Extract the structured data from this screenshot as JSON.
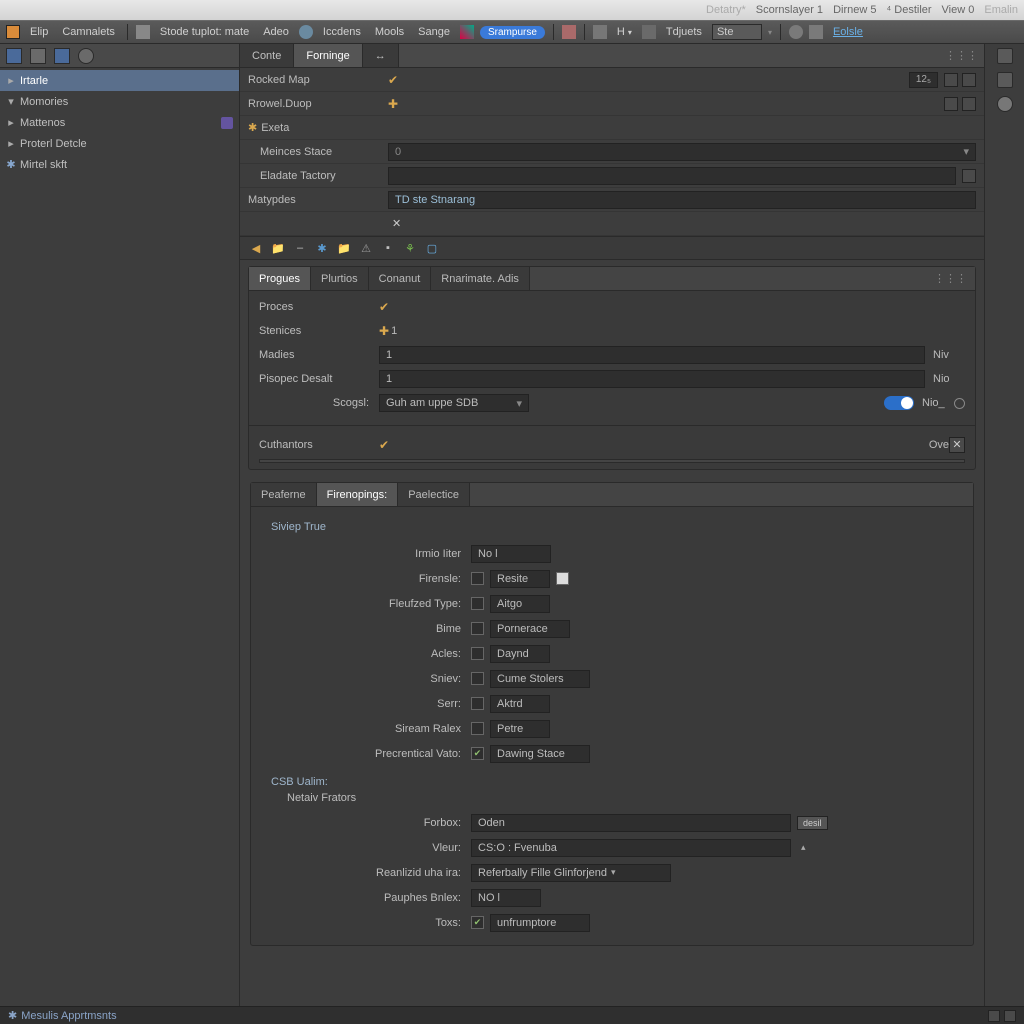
{
  "winbar": [
    "Detatry*",
    "Scornslayer 1",
    "Dirnew 5",
    "⁴ Destiler",
    "View 0",
    "Emalin"
  ],
  "menubar": {
    "items": [
      "Elip",
      "Camnalets",
      "Stode tuplot: mate",
      "Adeo",
      "Iccdens",
      "Mools",
      "Sange"
    ],
    "pill": "Srampurse",
    "right": [
      "H",
      "Tdjuets",
      "Ste"
    ],
    "link": "Eolsle"
  },
  "sidebar": {
    "items": [
      {
        "label": "Irtarle",
        "sel": true
      },
      {
        "label": "Momories"
      },
      {
        "label": "Mattenos",
        "badge": true
      },
      {
        "label": "Proterl Detcle"
      },
      {
        "label": "Mirtel skft",
        "gear": true
      }
    ]
  },
  "maintabs": [
    {
      "label": "Conte",
      "active": false
    },
    {
      "label": "Forninge",
      "active": true
    },
    {
      "label": "↔",
      "active": false
    }
  ],
  "topProps": {
    "rockedMap": {
      "label": "Rocked Map",
      "value": "",
      "check": true,
      "num": "12₅"
    },
    "rowelDuop": {
      "label": "Rrowel.Duop",
      "plus": true
    },
    "exeta": {
      "label": "Exeta"
    },
    "meincesStace": {
      "label": "Meinces Stace",
      "value": "0"
    },
    "eladateTactory": {
      "label": "Eladate Tactory",
      "value": ""
    },
    "matypdes": {
      "label": "Matypdes",
      "value": "TD ste Stnarang",
      "x": true
    }
  },
  "nested": {
    "tabs": [
      "Progues",
      "Plurtios",
      "Conanut",
      "Rnarimate. Adis"
    ],
    "rows": {
      "proces": {
        "label": "Proces",
        "check": true
      },
      "stenices": {
        "label": "Stenices",
        "plus": true,
        "value": "1"
      },
      "madies": {
        "label": "Madies",
        "value": "1",
        "suffix": "Niv"
      },
      "pisopec": {
        "label": "Pisopec Desalt",
        "value": "1",
        "suffix": "Nio"
      },
      "scogsl": {
        "label": "Scogsl:",
        "value": "Guh am uppe SDB",
        "toggle": true,
        "suffix": "Nio_"
      }
    },
    "cuthantors": {
      "label": "Cuthantors",
      "check": true,
      "suffix": "Ove"
    }
  },
  "opt": {
    "tabs": [
      "Peaferne",
      "Firenopings:",
      "Paelectice"
    ],
    "group1": "Siviep True",
    "rows1": [
      {
        "l": "Irmio Iiter",
        "v": "No l",
        "chk": false,
        "box": true
      },
      {
        "l": "Firensle:",
        "v": "Resite",
        "chk": true,
        "extra": true
      },
      {
        "l": "Fleufzed Type:",
        "v": "Aitgo",
        "chk": true
      },
      {
        "l": "Bime",
        "v": "Pornerace",
        "chk": true
      },
      {
        "l": "Acles:",
        "v": "Daynd",
        "chk": true
      },
      {
        "l": "Sniev:",
        "v": "Cume Stolers",
        "chk": true
      },
      {
        "l": "Serr:",
        "v": "Aktrd",
        "chk": true
      },
      {
        "l": "Siream Ralex",
        "v": "Petre",
        "chk": true
      },
      {
        "l": "Precrentical Vato:",
        "v": "Dawing Stace",
        "chk": true,
        "green": true
      }
    ],
    "sub1": "CSB Ualim:",
    "sub2": "Netaiv Frators",
    "rows2": [
      {
        "l": "Forbox:",
        "v": "Oden",
        "wide": true,
        "btn": "desil"
      },
      {
        "l": "Vleur:",
        "v": "CS:O : Fvenuba",
        "wide": true,
        "caret": true
      },
      {
        "l": "Reanlizid uha ira:",
        "v": "Referbally Fille Glinforjend",
        "med": true,
        "caret": true
      },
      {
        "l": "Pauphes Bnlex:",
        "v": "NO l",
        "box": true
      },
      {
        "l": "Toxs:",
        "v": "unfrumptore",
        "chk": true,
        "green": true
      }
    ]
  },
  "status": "Mesulis Apprtmsnts"
}
